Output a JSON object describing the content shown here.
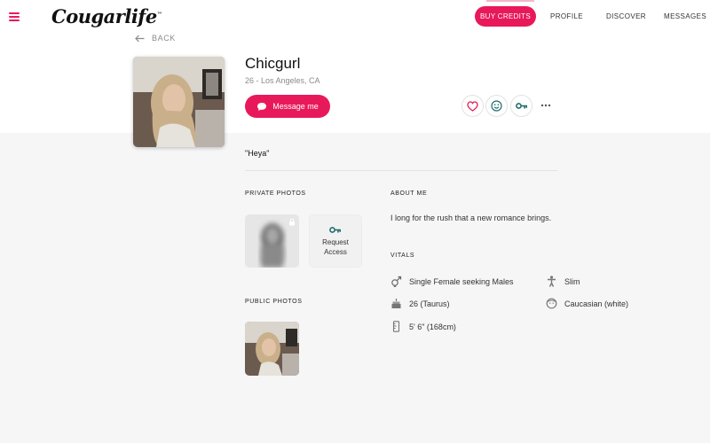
{
  "header": {
    "logo_text": "Cougarlife",
    "logo_mark": "™",
    "buy_credits_label": "BUY CREDITS",
    "nav": [
      "PROFILE",
      "DISCOVER",
      "MESSAGES"
    ]
  },
  "back_label": "BACK",
  "profile": {
    "name": "Chicgurl",
    "subline": "26 - Los Angeles, CA",
    "message_label": "Message me",
    "quote": "\"Heya\""
  },
  "private_photos": {
    "heading": "PRIVATE PHOTOS",
    "request_line1": "Request",
    "request_line2": "Access"
  },
  "public_photos": {
    "heading": "PUBLIC PHOTOS"
  },
  "about": {
    "heading": "ABOUT ME",
    "text": "I long for the rush that a new romance brings."
  },
  "vitals": {
    "heading": "VITALS",
    "seeking": "Single Female seeking Males",
    "age": "26 (Taurus)",
    "height": "5' 6\" (168cm)",
    "body": "Slim",
    "ethnicity": "Caucasian (white)"
  },
  "icons": {
    "menu": "hamburger-menu-icon",
    "back": "arrow-left-icon",
    "message": "chat-bubble-icon",
    "favorite": "heart-icon",
    "wink": "smiley-icon",
    "key": "key-icon",
    "more": "ellipsis-icon",
    "lock": "lock-icon",
    "gender": "gender-icon",
    "cake": "birthday-cake-icon",
    "ruler": "ruler-icon",
    "body": "person-icon",
    "face": "face-icon"
  },
  "colors": {
    "accent": "#e8195a",
    "teal": "#1f6e6a",
    "muted_text": "#8a8a8a",
    "page_bg": "#f6f6f7"
  }
}
